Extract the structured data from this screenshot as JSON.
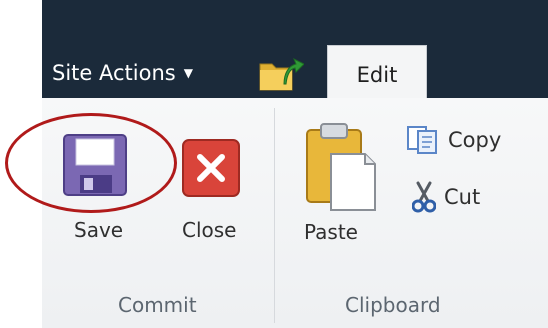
{
  "nav": {
    "site_actions_label": "Site Actions",
    "site_actions_caret": "▼",
    "edit_tab_label": "Edit"
  },
  "ribbon": {
    "commit": {
      "group_label": "Commit",
      "save_label": "Save",
      "close_label": "Close"
    },
    "clipboard": {
      "group_label": "Clipboard",
      "paste_label": "Paste",
      "copy_label": "Copy",
      "cut_label": "Cut"
    }
  },
  "icons": {
    "save": "floppy-disk-icon",
    "close": "red-x-icon",
    "paste": "clipboard-paste-icon",
    "copy": "copy-pages-icon",
    "cut": "scissors-icon",
    "navigate_up": "folder-up-arrow-icon"
  },
  "colors": {
    "topbar": "#1b2a3a",
    "highlight_circle": "#b01a1a",
    "save_icon": "#7b68b3",
    "close_icon": "#d9443a"
  }
}
